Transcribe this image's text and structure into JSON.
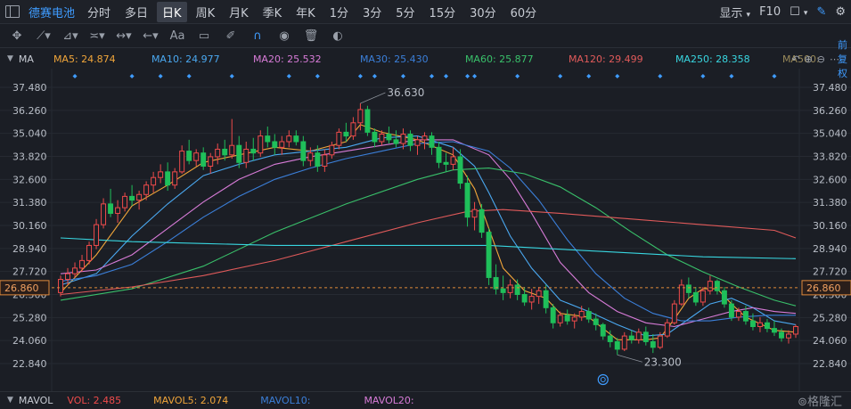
{
  "toolbar": {
    "stock_name": "德赛电池",
    "periods": [
      "分时",
      "多日",
      "日K",
      "周K",
      "月K",
      "季K",
      "年K",
      "1分",
      "3分",
      "5分",
      "15分",
      "30分",
      "60分"
    ],
    "active_period": "日K",
    "display_label": "显示",
    "f10_label": "F10",
    "font_label": "Aa"
  },
  "ma_bar": {
    "label": "MA",
    "items": [
      {
        "name": "MA5",
        "value": "24.874",
        "color": "#f0a53a"
      },
      {
        "name": "MA10",
        "value": "24.977",
        "color": "#4aa8f0"
      },
      {
        "name": "MA20",
        "value": "25.532",
        "color": "#d77bd7"
      },
      {
        "name": "MA30",
        "value": "25.430",
        "color": "#3b7fd9"
      },
      {
        "name": "MA60",
        "value": "25.877",
        "color": "#39c06a"
      },
      {
        "name": "MA120",
        "value": "29.499",
        "color": "#e05a5a"
      },
      {
        "name": "MA250",
        "value": "28.358",
        "color": "#38d6e0"
      },
      {
        "name": "MA500",
        "value": "",
        "color": "#9a8a5a"
      }
    ],
    "adjust_label": "前复权"
  },
  "bottom": {
    "mavol_label": "MAVOL",
    "vol": "VOL: 2.485",
    "mavol5": "MAVOL5: 2.074",
    "mavol10": "MAVOL10:",
    "mavol20": "MAVOL20:",
    "watermark": "格隆汇"
  },
  "colors": {
    "up": "#ef4b4b",
    "down": "#1fbf5a",
    "bg": "#1b1e25",
    "grid": "#2b2f37"
  },
  "chart_data": {
    "type": "candlestick",
    "yticks": [
      37.48,
      36.26,
      35.04,
      33.82,
      32.6,
      31.38,
      30.16,
      28.94,
      27.72,
      26.5,
      25.28,
      24.06,
      22.84
    ],
    "ylim": [
      21.9,
      38.1
    ],
    "current_price": 26.86,
    "annotations": [
      {
        "label": "36.630",
        "index": 42,
        "value": 36.63
      },
      {
        "label": "23.300",
        "index": 78,
        "value": 23.3
      }
    ],
    "ohlc": [
      [
        26.6,
        27.5,
        26.4,
        27.3
      ],
      [
        27.3,
        27.9,
        27.0,
        27.6
      ],
      [
        27.6,
        28.2,
        27.4,
        27.9
      ],
      [
        27.9,
        28.6,
        27.7,
        28.3
      ],
      [
        28.3,
        29.3,
        28.1,
        29.1
      ],
      [
        29.1,
        30.5,
        28.9,
        30.2
      ],
      [
        30.2,
        31.6,
        30.0,
        31.3
      ],
      [
        31.3,
        32.1,
        30.6,
        30.8
      ],
      [
        30.8,
        31.5,
        30.3,
        31.1
      ],
      [
        31.1,
        31.9,
        30.9,
        31.7
      ],
      [
        31.7,
        32.3,
        31.2,
        31.5
      ],
      [
        31.5,
        32.0,
        31.0,
        31.8
      ],
      [
        31.8,
        32.5,
        31.5,
        32.3
      ],
      [
        32.3,
        33.0,
        31.9,
        32.7
      ],
      [
        32.7,
        33.4,
        32.4,
        33.0
      ],
      [
        33.0,
        33.5,
        32.0,
        32.3
      ],
      [
        32.3,
        33.2,
        32.1,
        33.0
      ],
      [
        33.0,
        34.4,
        32.9,
        34.1
      ],
      [
        34.1,
        34.7,
        33.4,
        33.6
      ],
      [
        33.6,
        34.2,
        33.3,
        34.0
      ],
      [
        34.0,
        34.3,
        33.1,
        33.3
      ],
      [
        33.3,
        34.0,
        32.9,
        33.8
      ],
      [
        33.8,
        34.5,
        33.4,
        34.2
      ],
      [
        34.2,
        34.7,
        33.6,
        33.9
      ],
      [
        33.9,
        35.8,
        33.7,
        34.4
      ],
      [
        34.4,
        34.9,
        33.2,
        33.5
      ],
      [
        33.5,
        34.6,
        33.2,
        34.2
      ],
      [
        34.2,
        34.8,
        33.6,
        34.0
      ],
      [
        34.0,
        35.2,
        33.8,
        34.9
      ],
      [
        34.9,
        35.4,
        34.3,
        34.6
      ],
      [
        34.6,
        35.0,
        33.9,
        34.3
      ],
      [
        34.3,
        34.9,
        33.9,
        34.6
      ],
      [
        34.6,
        35.2,
        34.3,
        34.9
      ],
      [
        34.9,
        35.2,
        34.4,
        34.6
      ],
      [
        34.6,
        34.9,
        33.3,
        33.6
      ],
      [
        33.6,
        34.3,
        33.3,
        34.0
      ],
      [
        34.0,
        34.4,
        33.0,
        33.3
      ],
      [
        33.3,
        34.2,
        33.0,
        33.9
      ],
      [
        33.9,
        34.6,
        33.7,
        34.4
      ],
      [
        34.4,
        35.3,
        34.2,
        35.1
      ],
      [
        35.1,
        35.6,
        34.6,
        34.9
      ],
      [
        34.9,
        35.9,
        34.7,
        35.6
      ],
      [
        35.6,
        36.63,
        35.2,
        36.3
      ],
      [
        36.3,
        36.5,
        34.9,
        35.1
      ],
      [
        35.1,
        35.3,
        34.3,
        34.6
      ],
      [
        34.6,
        35.2,
        34.4,
        35.0
      ],
      [
        35.0,
        35.4,
        34.5,
        34.7
      ],
      [
        34.7,
        35.2,
        34.3,
        34.5
      ],
      [
        34.5,
        35.3,
        34.2,
        35.0
      ],
      [
        35.0,
        35.2,
        34.1,
        34.4
      ],
      [
        34.4,
        34.9,
        33.9,
        34.7
      ],
      [
        34.7,
        35.1,
        34.2,
        34.9
      ],
      [
        34.9,
        35.1,
        33.9,
        34.3
      ],
      [
        34.3,
        34.6,
        33.2,
        33.5
      ],
      [
        33.5,
        34.0,
        33.0,
        33.4
      ],
      [
        33.4,
        34.3,
        33.1,
        33.8
      ],
      [
        33.8,
        34.2,
        32.1,
        32.4
      ],
      [
        32.4,
        32.8,
        30.1,
        30.6
      ],
      [
        30.6,
        31.4,
        29.9,
        31.0
      ],
      [
        31.0,
        31.3,
        29.5,
        29.8
      ],
      [
        29.8,
        30.0,
        27.0,
        27.4
      ],
      [
        27.4,
        28.1,
        26.5,
        26.8
      ],
      [
        26.8,
        27.5,
        26.2,
        26.6
      ],
      [
        26.6,
        27.3,
        26.3,
        27.0
      ],
      [
        27.0,
        27.3,
        26.2,
        26.5
      ],
      [
        26.5,
        26.9,
        25.9,
        26.1
      ],
      [
        26.1,
        26.8,
        25.7,
        26.4
      ],
      [
        26.4,
        26.9,
        26.0,
        26.7
      ],
      [
        26.7,
        27.0,
        25.5,
        25.8
      ],
      [
        25.8,
        26.0,
        24.7,
        25.0
      ],
      [
        25.0,
        25.6,
        24.8,
        25.4
      ],
      [
        25.4,
        25.7,
        24.9,
        25.1
      ],
      [
        25.1,
        25.5,
        24.7,
        25.3
      ],
      [
        25.3,
        25.9,
        25.1,
        25.6
      ],
      [
        25.6,
        25.8,
        25.0,
        25.2
      ],
      [
        25.2,
        25.5,
        24.6,
        24.9
      ],
      [
        24.9,
        25.0,
        24.1,
        24.3
      ],
      [
        24.3,
        24.6,
        23.7,
        24.0
      ],
      [
        24.0,
        24.2,
        23.3,
        23.6
      ],
      [
        23.6,
        24.5,
        23.5,
        24.3
      ],
      [
        24.3,
        24.6,
        23.9,
        24.1
      ],
      [
        24.1,
        24.7,
        23.9,
        24.5
      ],
      [
        24.5,
        24.8,
        23.8,
        24.0
      ],
      [
        24.0,
        24.4,
        23.4,
        23.7
      ],
      [
        23.7,
        24.5,
        23.6,
        24.3
      ],
      [
        24.3,
        25.2,
        24.2,
        25.0
      ],
      [
        25.0,
        26.2,
        24.9,
        26.0
      ],
      [
        26.0,
        27.3,
        25.9,
        27.0
      ],
      [
        27.0,
        27.4,
        26.3,
        26.6
      ],
      [
        26.6,
        26.9,
        25.9,
        26.1
      ],
      [
        26.1,
        26.9,
        25.9,
        26.7
      ],
      [
        26.7,
        27.5,
        26.5,
        27.2
      ],
      [
        27.2,
        27.3,
        26.5,
        26.7
      ],
      [
        26.7,
        26.9,
        25.8,
        26.0
      ],
      [
        26.0,
        26.2,
        25.1,
        25.3
      ],
      [
        25.3,
        25.8,
        25.1,
        25.6
      ],
      [
        25.6,
        25.9,
        24.9,
        25.1
      ],
      [
        25.1,
        25.5,
        24.6,
        24.8
      ],
      [
        24.8,
        25.3,
        24.5,
        25.0
      ],
      [
        25.0,
        25.2,
        24.5,
        24.7
      ],
      [
        24.7,
        25.1,
        24.3,
        24.5
      ],
      [
        24.5,
        24.7,
        24.0,
        24.2
      ],
      [
        24.2,
        24.6,
        23.9,
        24.4
      ],
      [
        24.4,
        24.9,
        24.2,
        24.8
      ]
    ],
    "series": [
      {
        "name": "MA5",
        "color": "#f0a53a",
        "points": [
          [
            0,
            26.6
          ],
          [
            5,
            28.6
          ],
          [
            10,
            31.2
          ],
          [
            15,
            32.3
          ],
          [
            20,
            33.5
          ],
          [
            25,
            33.9
          ],
          [
            30,
            34.3
          ],
          [
            35,
            34.1
          ],
          [
            40,
            34.6
          ],
          [
            42,
            35.5
          ],
          [
            45,
            35.1
          ],
          [
            50,
            34.7
          ],
          [
            55,
            33.9
          ],
          [
            58,
            32.1
          ],
          [
            60,
            30.0
          ],
          [
            62,
            27.9
          ],
          [
            65,
            26.7
          ],
          [
            68,
            26.3
          ],
          [
            70,
            25.5
          ],
          [
            74,
            25.3
          ],
          [
            76,
            24.7
          ],
          [
            78,
            24.1
          ],
          [
            82,
            24.1
          ],
          [
            84,
            24.2
          ],
          [
            86,
            25.2
          ],
          [
            88,
            26.3
          ],
          [
            90,
            26.8
          ],
          [
            92,
            26.8
          ],
          [
            94,
            26.0
          ],
          [
            96,
            25.3
          ],
          [
            100,
            24.6
          ],
          [
            103,
            24.5
          ]
        ]
      },
      {
        "name": "MA10",
        "color": "#4aa8f0",
        "points": [
          [
            0,
            27.0
          ],
          [
            5,
            27.6
          ],
          [
            10,
            29.6
          ],
          [
            15,
            31.3
          ],
          [
            20,
            32.8
          ],
          [
            25,
            33.4
          ],
          [
            30,
            33.9
          ],
          [
            35,
            34.1
          ],
          [
            40,
            34.3
          ],
          [
            45,
            34.8
          ],
          [
            50,
            34.9
          ],
          [
            55,
            34.3
          ],
          [
            58,
            33.3
          ],
          [
            60,
            31.9
          ],
          [
            63,
            29.6
          ],
          [
            66,
            27.9
          ],
          [
            70,
            26.2
          ],
          [
            74,
            25.6
          ],
          [
            78,
            24.9
          ],
          [
            82,
            24.3
          ],
          [
            85,
            24.4
          ],
          [
            88,
            25.2
          ],
          [
            91,
            26.0
          ],
          [
            94,
            26.3
          ],
          [
            97,
            25.8
          ],
          [
            100,
            25.1
          ],
          [
            103,
            24.9
          ]
        ]
      },
      {
        "name": "MA20",
        "color": "#d77bd7",
        "points": [
          [
            0,
            27.6
          ],
          [
            5,
            27.8
          ],
          [
            10,
            28.6
          ],
          [
            15,
            30.0
          ],
          [
            20,
            31.4
          ],
          [
            25,
            32.6
          ],
          [
            30,
            33.4
          ],
          [
            35,
            33.8
          ],
          [
            40,
            34.1
          ],
          [
            45,
            34.4
          ],
          [
            50,
            34.7
          ],
          [
            55,
            34.7
          ],
          [
            60,
            33.9
          ],
          [
            63,
            32.6
          ],
          [
            66,
            30.8
          ],
          [
            70,
            28.2
          ],
          [
            74,
            26.6
          ],
          [
            78,
            25.6
          ],
          [
            82,
            25.0
          ],
          [
            86,
            24.8
          ],
          [
            90,
            25.2
          ],
          [
            94,
            25.6
          ],
          [
            97,
            25.8
          ],
          [
            100,
            25.6
          ],
          [
            103,
            25.5
          ]
        ]
      },
      {
        "name": "MA30",
        "color": "#3b7fd9",
        "points": [
          [
            0,
            27.2
          ],
          [
            5,
            27.5
          ],
          [
            10,
            28.1
          ],
          [
            15,
            29.3
          ],
          [
            20,
            30.6
          ],
          [
            25,
            31.7
          ],
          [
            30,
            32.6
          ],
          [
            35,
            33.2
          ],
          [
            40,
            33.7
          ],
          [
            45,
            34.1
          ],
          [
            50,
            34.5
          ],
          [
            55,
            34.6
          ],
          [
            60,
            34.1
          ],
          [
            63,
            33.2
          ],
          [
            67,
            31.5
          ],
          [
            71,
            29.4
          ],
          [
            75,
            27.6
          ],
          [
            79,
            26.3
          ],
          [
            83,
            25.5
          ],
          [
            87,
            25.1
          ],
          [
            91,
            25.1
          ],
          [
            95,
            25.3
          ],
          [
            99,
            25.4
          ],
          [
            103,
            25.4
          ]
        ]
      },
      {
        "name": "MA60",
        "color": "#39c06a",
        "points": [
          [
            0,
            26.2
          ],
          [
            10,
            26.8
          ],
          [
            20,
            28.0
          ],
          [
            30,
            29.8
          ],
          [
            40,
            31.3
          ],
          [
            50,
            32.6
          ],
          [
            55,
            33.1
          ],
          [
            60,
            33.2
          ],
          [
            65,
            32.9
          ],
          [
            70,
            32.2
          ],
          [
            75,
            31.1
          ],
          [
            80,
            29.8
          ],
          [
            85,
            28.6
          ],
          [
            90,
            27.7
          ],
          [
            95,
            26.9
          ],
          [
            100,
            26.2
          ],
          [
            103,
            25.9
          ]
        ]
      },
      {
        "name": "MA120",
        "color": "#e05a5a",
        "points": [
          [
            0,
            26.5
          ],
          [
            10,
            26.9
          ],
          [
            20,
            27.5
          ],
          [
            30,
            28.3
          ],
          [
            40,
            29.3
          ],
          [
            50,
            30.3
          ],
          [
            57,
            30.9
          ],
          [
            62,
            31.0
          ],
          [
            70,
            30.8
          ],
          [
            80,
            30.5
          ],
          [
            90,
            30.2
          ],
          [
            100,
            29.9
          ],
          [
            103,
            29.5
          ]
        ]
      },
      {
        "name": "MA250",
        "color": "#38d6e0",
        "points": [
          [
            0,
            29.5
          ],
          [
            10,
            29.3
          ],
          [
            20,
            29.2
          ],
          [
            30,
            29.1
          ],
          [
            40,
            29.1
          ],
          [
            50,
            29.1
          ],
          [
            60,
            29.1
          ],
          [
            70,
            28.9
          ],
          [
            80,
            28.7
          ],
          [
            90,
            28.5
          ],
          [
            103,
            28.4
          ]
        ]
      }
    ]
  }
}
